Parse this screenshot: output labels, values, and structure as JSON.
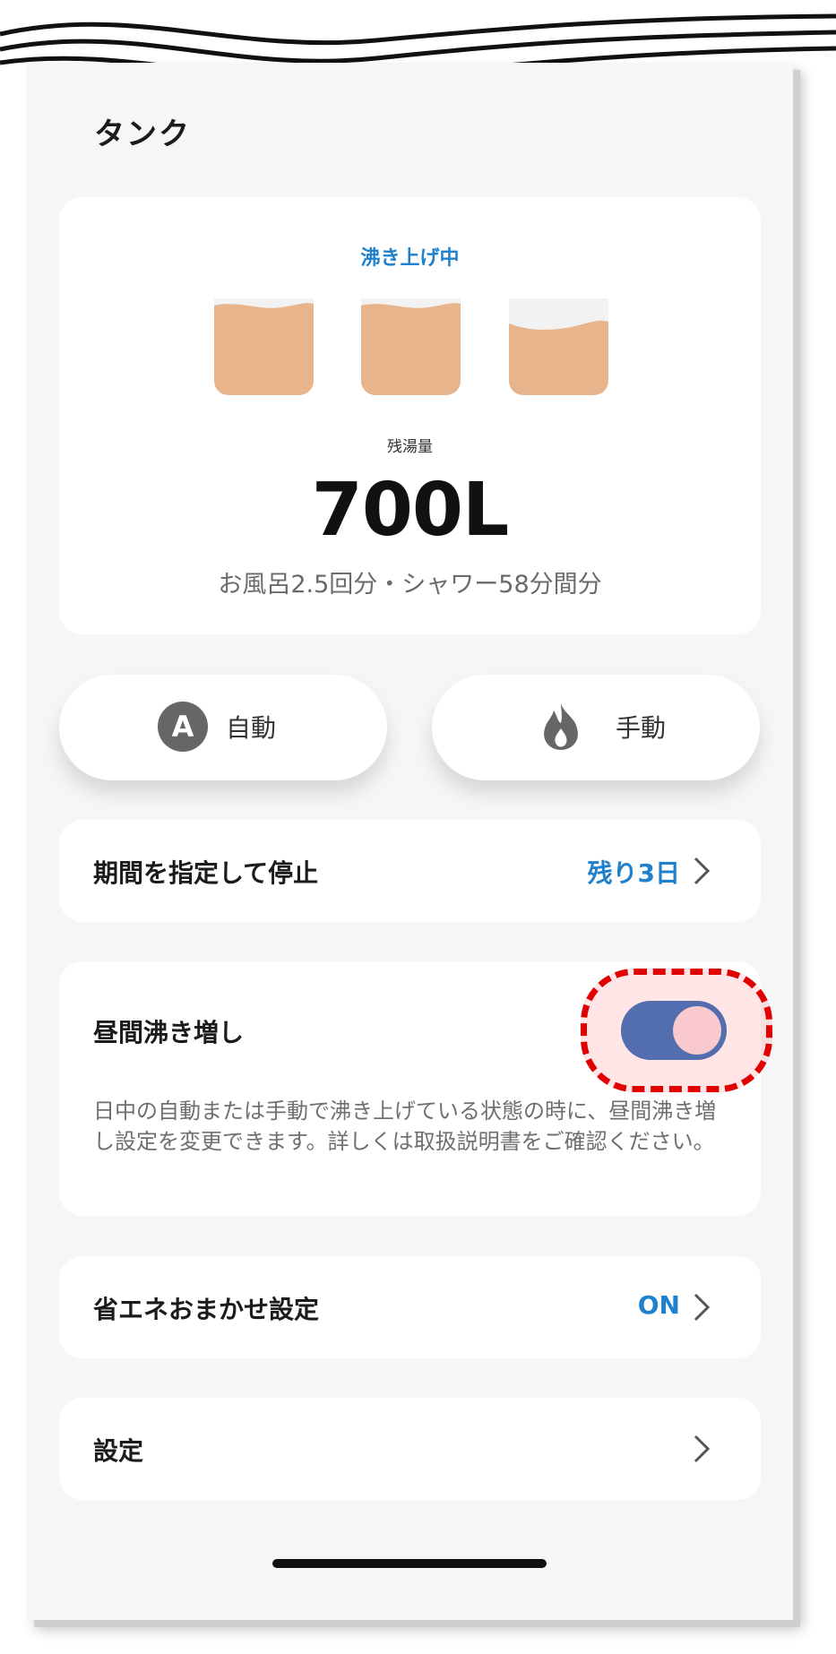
{
  "page": {
    "title": "タンク"
  },
  "tank": {
    "status": "沸き上げ中",
    "remaining_label": "残湯量",
    "remaining_value": "700L",
    "remaining_detail": "お風呂2.5回分・シャワー58分間分",
    "tank_fill_levels": [
      1.0,
      1.0,
      0.75
    ],
    "fill_color": "#e7b48c",
    "status_color": "#1f80cc"
  },
  "modes": {
    "auto_icon_letter": "A",
    "auto_label": "自動",
    "manual_label": "手動",
    "manual_icon": "flame-icon"
  },
  "stop_period": {
    "title": "期間を指定して停止",
    "value": "残り3日"
  },
  "daytime_reheat": {
    "title": "昼間沸き増し",
    "toggle_on": true,
    "description": "日中の自動または手動で沸き上げている状態の時に、昼間沸き増し設定を変更できます。詳しくは取扱説明書をご確認ください。"
  },
  "eco_setting": {
    "title": "省エネおまかせ設定",
    "value": "ON"
  },
  "settings": {
    "title": "設定"
  },
  "colors": {
    "accent": "#1f80cc",
    "toggle_on": "#3c78c1",
    "highlight": "#e10000"
  }
}
